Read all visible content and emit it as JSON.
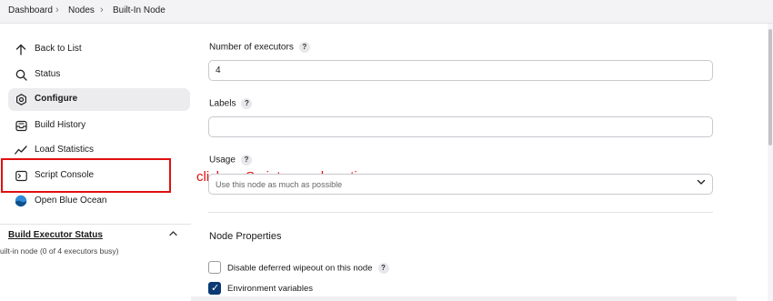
{
  "breadcrumb": {
    "items": [
      "Dashboard",
      "Nodes",
      "Built-In Node"
    ],
    "separator": "›"
  },
  "sidebar": {
    "items": [
      {
        "label": "Back to List",
        "icon": "arrow-up-icon"
      },
      {
        "label": "Status",
        "icon": "search-icon"
      },
      {
        "label": "Configure",
        "icon": "gear-icon",
        "active": true
      },
      {
        "label": "Build History",
        "icon": "inbox-icon"
      },
      {
        "label": "Load Statistics",
        "icon": "trend-icon"
      },
      {
        "label": "Script Console",
        "icon": "terminal-icon"
      },
      {
        "label": "Open Blue Ocean",
        "icon": "blue-ocean-icon"
      }
    ],
    "build_executor_status": {
      "title": "Build Executor Status",
      "subtitle": "uilt-in node (0 of 4 executors busy)"
    }
  },
  "annotation": {
    "text": "click on Script console option",
    "color": "#e01010"
  },
  "form": {
    "executors": {
      "label": "Number of executors",
      "help": "?",
      "value": "4"
    },
    "labels": {
      "label": "Labels",
      "help": "?",
      "value": ""
    },
    "usage": {
      "label": "Usage",
      "help": "?",
      "value": "Use this node as much as possible"
    },
    "node_properties": {
      "title": "Node Properties",
      "options": [
        {
          "label": "Disable deferred wipeout on this node",
          "checked": false,
          "help": "?"
        },
        {
          "label": "Environment variables",
          "checked": true
        }
      ]
    }
  },
  "colors": {
    "accent_checkbox": "#0b3a72",
    "breadcrumb_bg": "#f3f3f5",
    "active_item_bg": "#ececef"
  }
}
